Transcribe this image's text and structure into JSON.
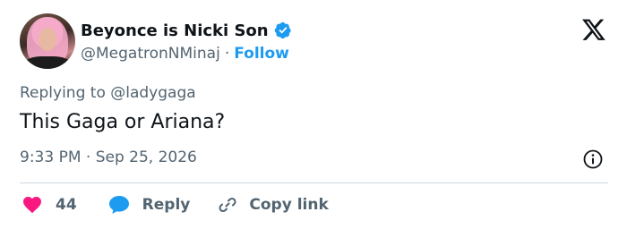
{
  "author": {
    "display_name": "Beyonce is Nicki Son",
    "handle": "@MegatronNMinaj",
    "separator": "·",
    "follow_label": "Follow"
  },
  "tweet": {
    "replying_prefix": "Replying to",
    "replying_to": "@ladygaga",
    "text": "This Gaga or Ariana?",
    "time": "9:33 PM",
    "date_separator": "·",
    "date": "Sep 25, 2026"
  },
  "actions": {
    "like_count": "44",
    "reply_label": "Reply",
    "copy_link_label": "Copy link"
  },
  "icons": {
    "verified": "verified-badge-icon",
    "x_logo": "x-logo-icon",
    "info": "info-icon",
    "heart": "heart-icon",
    "reply": "speech-bubble-icon",
    "link": "link-icon"
  },
  "colors": {
    "accent": "#1d9bf0",
    "like": "#f91880",
    "text": "#0f1419",
    "secondary_text": "#536471",
    "divider": "#cfd9de"
  }
}
